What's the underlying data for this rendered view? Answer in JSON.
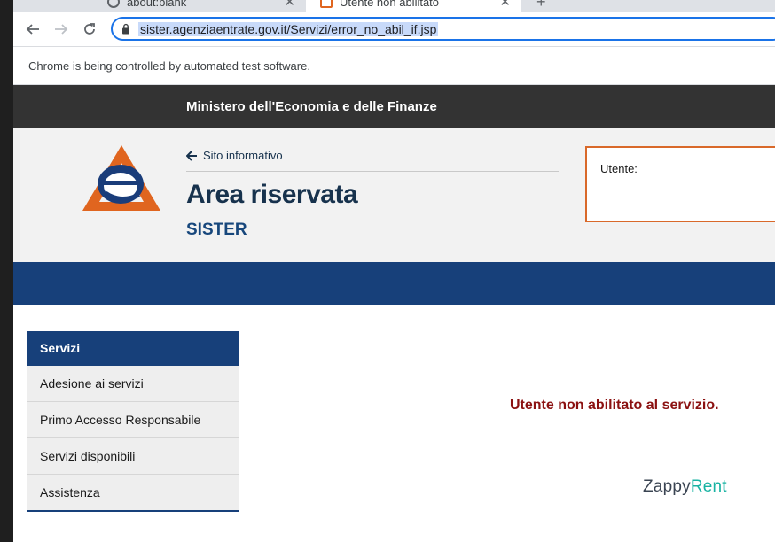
{
  "browser": {
    "tabs": [
      {
        "title": "about:blank"
      },
      {
        "title": "Utente non abilitato"
      }
    ],
    "url": "sister.agenziaentrate.gov.it/Servizi/error_no_abil_if.jsp",
    "infobar": "Chrome is being controlled by automated test software."
  },
  "page": {
    "ministry": "Ministero dell'Economia e delle Finanze",
    "back_link": "Sito informativo",
    "title": "Area riservata",
    "subtitle": "SISTER",
    "user_label": "Utente:",
    "menu": {
      "header": "Servizi",
      "items": [
        {
          "label": "Adesione ai servizi"
        },
        {
          "label": "Primo Accesso Responsabile"
        },
        {
          "label": "Servizi disponibili"
        },
        {
          "label": "Assistenza"
        }
      ]
    },
    "error_message": "Utente non abilitato al servizio.",
    "watermark": {
      "part1": "Zappy",
      "part2": "Rent"
    }
  },
  "colors": {
    "primary_blue": "#17407a",
    "dark_bar": "#333333",
    "accent_orange": "#d9692a",
    "error_red": "#8b1111",
    "zappy_teal": "#19b3a3"
  }
}
